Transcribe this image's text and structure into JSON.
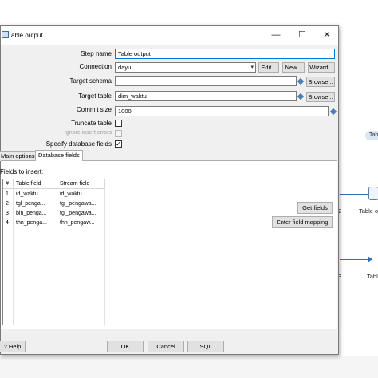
{
  "background": {
    "pill_label": "Tab",
    "node_label_1": "Table o",
    "node_label_2": "Tabl",
    "fragment_2": "2",
    "fragment_3": "3"
  },
  "dialog": {
    "title": "Table output",
    "icon": "table-output-icon",
    "window_buttons": {
      "minimize": "—",
      "maximize": "☐",
      "close": "✕"
    },
    "step_name": {
      "label": "Step name",
      "value": "Table output"
    },
    "connection": {
      "label": "Connection",
      "value": "dayu",
      "edit": "Edit...",
      "new": "New...",
      "wizard": "Wizard..."
    },
    "target_schema": {
      "label": "Target schema",
      "value": "",
      "browse": "Browse..."
    },
    "target_table": {
      "label": "Target table",
      "value": "dim_waktu",
      "browse": "Browse..."
    },
    "commit_size": {
      "label": "Commit size",
      "value": "1000"
    },
    "truncate_table": {
      "label": "Truncate table",
      "checked": false
    },
    "ignore_insert_errors": {
      "label": "Ignore insert errors",
      "checked": false,
      "enabled": false
    },
    "specify_database_fields": {
      "label": "Specify database fields",
      "checked": true,
      "mark": "✓"
    },
    "tabs": [
      {
        "label": "Main options",
        "active": false
      },
      {
        "label": "Database fields",
        "active": true
      }
    ],
    "fields": {
      "title": "Fields to insert:",
      "columns": [
        "#",
        "Table field",
        "Stream field"
      ],
      "rows": [
        [
          "1",
          "id_waktu",
          "id_waktu"
        ],
        [
          "2",
          "tgl_penga...",
          "tgl_pengawa..."
        ],
        [
          "3",
          "bln_penga...",
          "tgl_pengawa..."
        ],
        [
          "4",
          "thn_penga...",
          "thn_pengaw..."
        ]
      ],
      "get_fields": "Get fields",
      "enter_mapping": "Enter field mapping"
    },
    "footer": {
      "help": "Help",
      "ok": "OK",
      "cancel": "Cancel",
      "sql": "SQL"
    },
    "colors": {
      "accent": "#0078d7",
      "hop": "#2c6fb5",
      "diamond": "#4a7fb8"
    }
  }
}
